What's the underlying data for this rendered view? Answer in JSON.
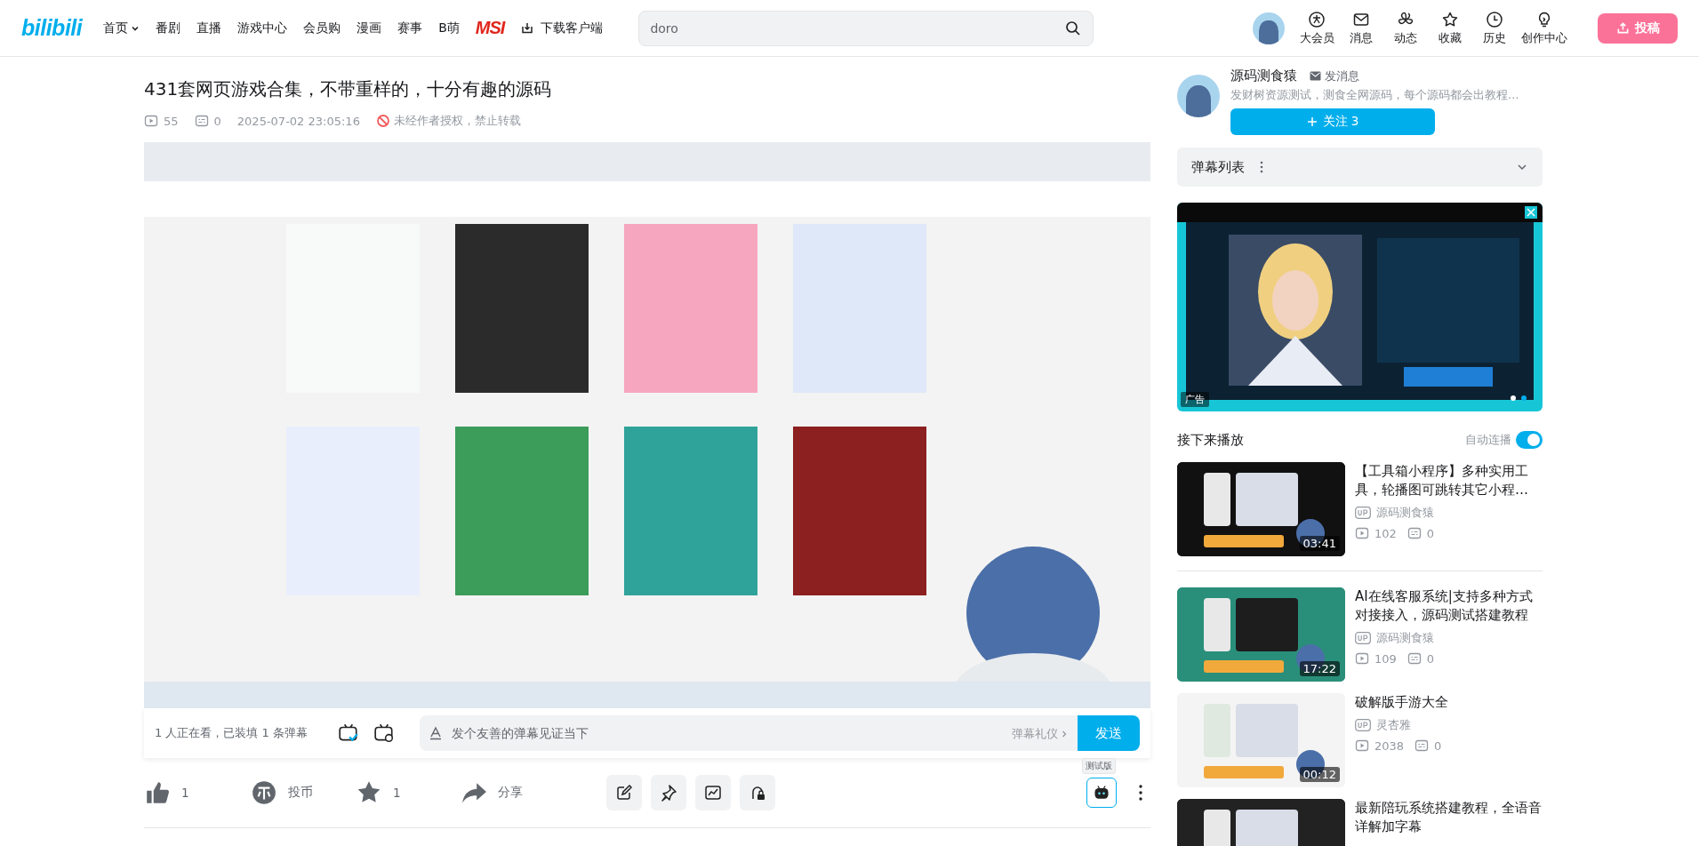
{
  "header": {
    "logo": "bilibili",
    "nav": [
      {
        "label": "首页",
        "kind": "dropdown"
      },
      {
        "label": "番剧",
        "kind": "link"
      },
      {
        "label": "直播",
        "kind": "link"
      },
      {
        "label": "游戏中心",
        "kind": "link"
      },
      {
        "label": "会员购",
        "kind": "link"
      },
      {
        "label": "漫画",
        "kind": "link"
      },
      {
        "label": "赛事",
        "kind": "link"
      },
      {
        "label": "B萌",
        "kind": "link"
      },
      {
        "label": "MSI",
        "kind": "brand"
      },
      {
        "label": "下载客户端",
        "kind": "download"
      }
    ],
    "search": {
      "placeholder": "doro"
    },
    "actions": [
      {
        "label": "大会员",
        "kind": "vip"
      },
      {
        "label": "消息",
        "kind": "mail"
      },
      {
        "label": "动态",
        "kind": "fan"
      },
      {
        "label": "收藏",
        "kind": "star"
      },
      {
        "label": "历史",
        "kind": "clock"
      },
      {
        "label": "创作中心",
        "kind": "bulb"
      }
    ],
    "upload": "投稿"
  },
  "video": {
    "title": "431套网页游戏合集，不带重样的，十分有趣的源码",
    "views": "55",
    "danmaku": "0",
    "date": "2025-07-02 23:05:16",
    "notice": "未经作者授权，禁止转载"
  },
  "danmaku_bar": {
    "watching": "1 人正在看，已装填 1 条弹幕",
    "placeholder": "发个友善的弹幕见证当下",
    "etiquette": "弹幕礼仪",
    "send": "发送"
  },
  "toolbar": {
    "like": "1",
    "coin": "投币",
    "favorite": "1",
    "share": "分享",
    "badge": "测试版"
  },
  "uploader": {
    "name": "源码测食猿",
    "message": "发消息",
    "description": "发财树资源测试，测食全网源码，每个源码都会出教程…",
    "follow": "关注 3"
  },
  "danmaku_list": {
    "title": "弹幕列表"
  },
  "ad": {
    "badge": "广告",
    "dots": [
      {
        "selected": false
      },
      {
        "selected": true
      }
    ]
  },
  "next": {
    "title": "接下来播放",
    "autoplay": {
      "label": "自动连播",
      "on": true
    },
    "items": [
      {
        "title": "【工具箱小程序】多种实用工具，轮播图可跳转其它小程…",
        "uploader": "源码测食猿",
        "views": "102",
        "danmaku": "0",
        "duration": "03:41"
      },
      {
        "title": "AI在线客服系统|支持多种方式对接接入，源码测试搭建教程",
        "uploader": "源码测食猿",
        "views": "109",
        "danmaku": "0",
        "duration": "17:22"
      },
      {
        "title": "破解版手游大全",
        "uploader": "灵杏雅",
        "views": "2038",
        "danmaku": "0",
        "duration": "00:12"
      },
      {
        "title": "最新陪玩系统搭建教程，全语音详解加字幕"
      }
    ]
  }
}
